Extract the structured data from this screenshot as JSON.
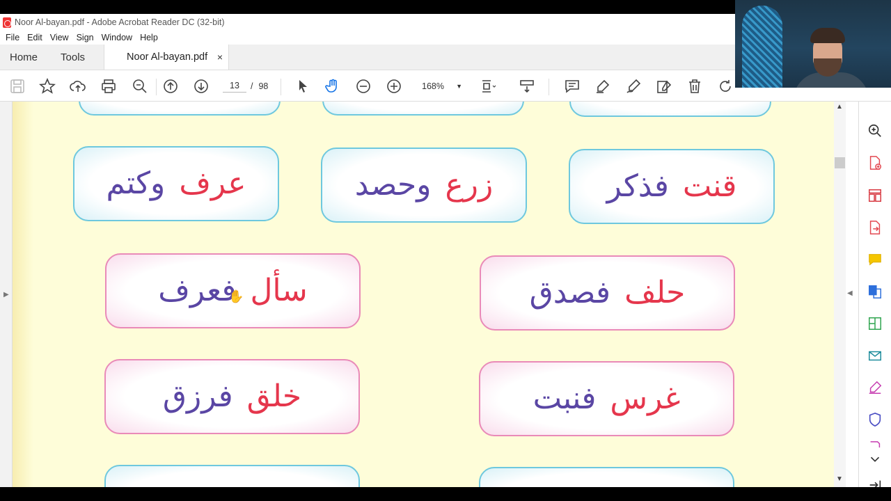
{
  "window": {
    "title": "Noor Al-bayan.pdf - Adobe Acrobat Reader DC (32-bit)"
  },
  "menu": [
    "File",
    "Edit",
    "View",
    "Sign",
    "Window",
    "Help"
  ],
  "tabs": {
    "home": "Home",
    "tools": "Tools",
    "document": "Noor Al-bayan.pdf",
    "close": "×"
  },
  "toolbar": {
    "current_page": "13",
    "separator": "/",
    "total_pages": "98",
    "zoom": "168%"
  },
  "cards_row1": [
    {
      "color": "blue",
      "words": [
        {
          "text": "قنت",
          "color": "red"
        },
        {
          "text": "فذكر",
          "color": "purple"
        }
      ]
    },
    {
      "color": "blue",
      "words": [
        {
          "text": "زرع",
          "color": "red"
        },
        {
          "text": "وحصد",
          "color": "purple"
        }
      ]
    },
    {
      "color": "blue",
      "words": [
        {
          "text": "عرف",
          "color": "red"
        },
        {
          "text": "وكتم",
          "color": "purple"
        }
      ]
    }
  ],
  "cards_row2": [
    {
      "color": "pink",
      "words": [
        {
          "text": "حلف",
          "color": "red"
        },
        {
          "text": "فصدق",
          "color": "purple"
        }
      ]
    },
    {
      "color": "pink",
      "words": [
        {
          "text": "سأل",
          "color": "red"
        },
        {
          "text": "فعرف",
          "color": "purple"
        }
      ]
    }
  ],
  "cards_row3": [
    {
      "color": "pink",
      "words": [
        {
          "text": "غرس",
          "color": "red"
        },
        {
          "text": "فنبت",
          "color": "purple"
        }
      ]
    },
    {
      "color": "pink",
      "words": [
        {
          "text": "خلق",
          "color": "red"
        },
        {
          "text": "فرزق",
          "color": "purple"
        }
      ]
    }
  ],
  "colors": {
    "red": "#e5364c",
    "purple": "#5a46a4",
    "page_bg": "#fefdd9",
    "blue_border": "#6ec8de",
    "pink_border": "#e98ab8"
  }
}
